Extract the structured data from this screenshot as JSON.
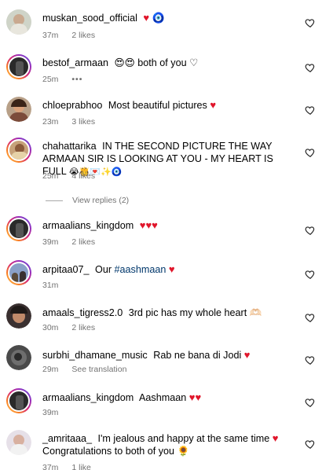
{
  "comments": [
    {
      "user": "muskan_sood_official",
      "text": "",
      "emoji": "♥ 🧿",
      "time": "37m",
      "likes": "2 likes"
    },
    {
      "user": "bestof_armaan",
      "text": "😍😍 both of you ♡",
      "emoji": "",
      "time": "25m",
      "likes": "•••"
    },
    {
      "user": "chloeprabhoo",
      "text": "Most beautiful pictures",
      "emoji": "♥",
      "time": "23m",
      "likes": "3 likes"
    },
    {
      "user": "chahattarika",
      "text": "IN THE SECOND PICTURE THE WAY ARMAAN SIR IS LOOKING AT YOU - MY HEART IS FULL",
      "emoji": "😭🫅💌✨🧿",
      "time": "25m",
      "likes": "4 likes"
    },
    {
      "user": "armaalians_kingdom",
      "text": "",
      "emoji": "♥♥♥",
      "time": "39m",
      "likes": "2 likes"
    },
    {
      "user": "arpitaa07_",
      "text": "Our",
      "hashtag": "#aashmaan",
      "emoji": "♥",
      "time": "31m",
      "likes": ""
    },
    {
      "user": "amaals_tigress2.0",
      "text": "3rd pic has my whole heart 🫶🏻",
      "emoji": "",
      "time": "30m",
      "likes": "2 likes"
    },
    {
      "user": "surbhi_dhamane_music",
      "text": "Rab ne bana di Jodi",
      "emoji": "♥",
      "time": "29m",
      "likes": "See translation"
    },
    {
      "user": "armaalians_kingdom",
      "text": "Aashmaan",
      "emoji": "♥♥",
      "time": "39m",
      "likes": ""
    },
    {
      "user": "_amritaaa_",
      "text": "I'm jealous and happy at the same time",
      "emoji": "♥",
      "text2": "Congratulations to both of you 🌻",
      "time": "37m",
      "likes": "1 like"
    }
  ],
  "view_replies": "View replies (2)",
  "colors": {
    "accent_heart": "#e0162b",
    "meta": "#737373",
    "hashtag": "#00376b"
  }
}
